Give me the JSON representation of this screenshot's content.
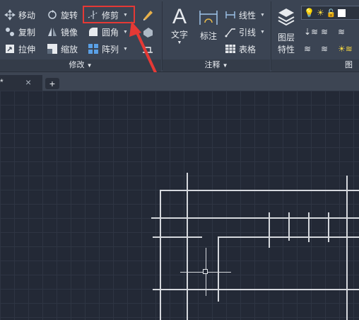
{
  "modify": {
    "move": "移动",
    "rotate": "旋转",
    "trim": "修剪",
    "copy": "复制",
    "mirror": "镜像",
    "fillet": "圆角",
    "stretch": "拉伸",
    "scale": "缩放",
    "array": "阵列",
    "title": "修改"
  },
  "annotation": {
    "text": "文字",
    "dimension": "标注",
    "linear": "线性",
    "leader": "引线",
    "table": "表格",
    "title": "注释"
  },
  "layers": {
    "properties_line1": "图层",
    "properties_line2": "特性",
    "title": "图层"
  },
  "tabs": {
    "doc_marker": "*",
    "close": "×",
    "new": "+"
  },
  "colors": {
    "highlight": "#e53935",
    "ribbon": "#3b4453",
    "canvas": "#232936"
  }
}
